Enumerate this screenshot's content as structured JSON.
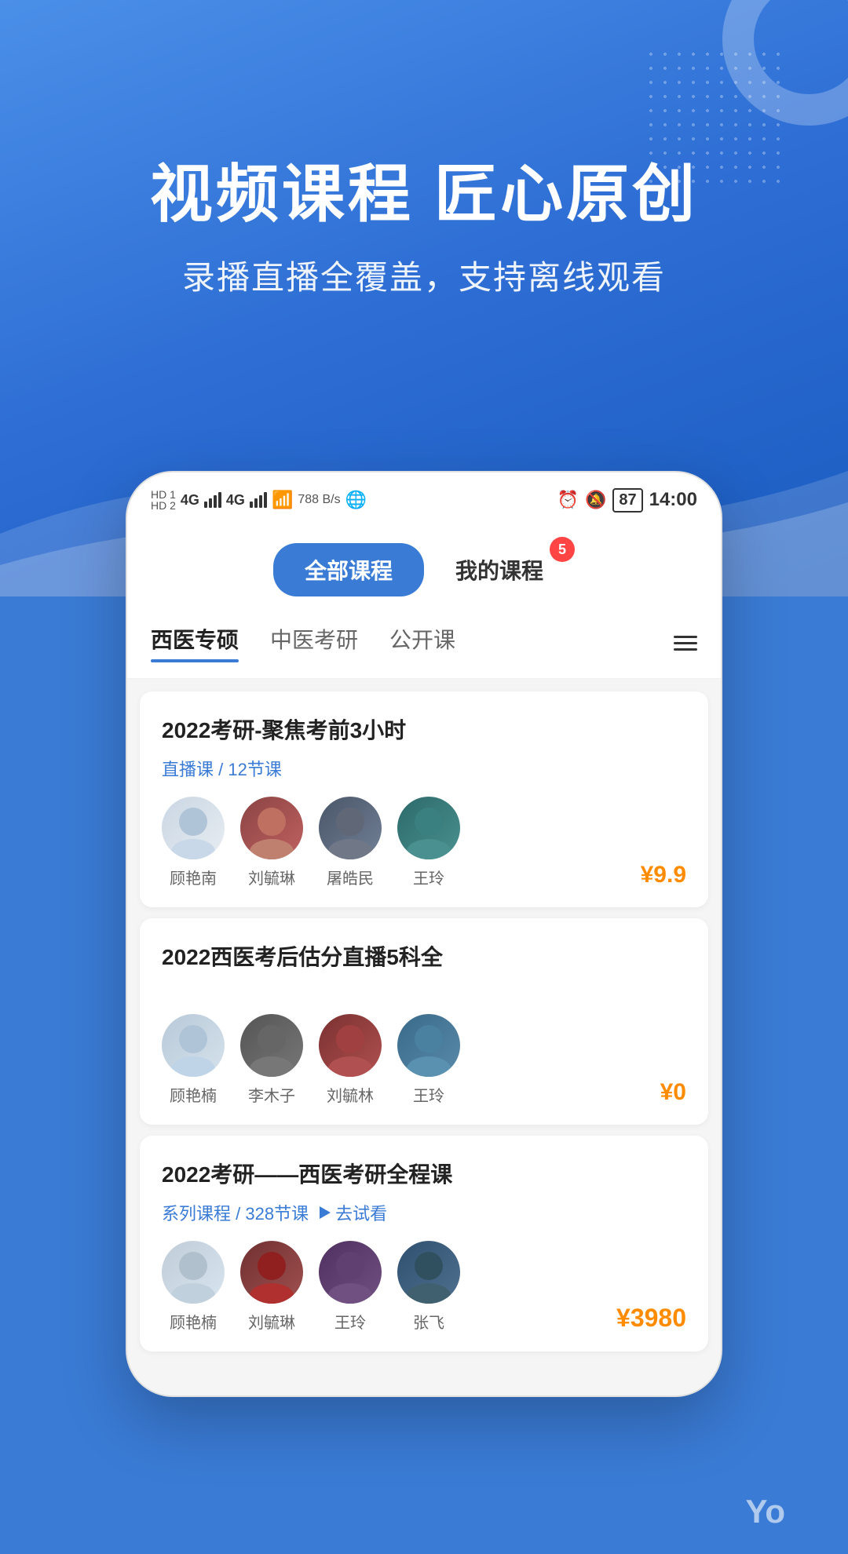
{
  "hero": {
    "title": "视频课程 匠心原创",
    "subtitle": "录播直播全覆盖，支持离线观看"
  },
  "statusBar": {
    "networks": "HD1 4G HD2 4G",
    "speed": "788 B/s",
    "time": "14:00",
    "battery": "87"
  },
  "tabs": {
    "all_label": "全部课程",
    "my_label": "我的课程",
    "badge": "5"
  },
  "categories": [
    {
      "label": "西医专硕",
      "active": true
    },
    {
      "label": "中医考研",
      "active": false
    },
    {
      "label": "公开课",
      "active": false
    }
  ],
  "courses": [
    {
      "title": "2022考研-聚焦考前3小时",
      "meta_type": "直播课",
      "meta_lessons": "12节课",
      "has_try": false,
      "teachers": [
        {
          "name": "顾艳南",
          "avatar_class": "avatar-1"
        },
        {
          "name": "刘毓琳",
          "avatar_class": "avatar-2"
        },
        {
          "name": "屠皓民",
          "avatar_class": "avatar-3"
        },
        {
          "name": "王玲",
          "avatar_class": "avatar-4"
        }
      ],
      "price": "¥9.9"
    },
    {
      "title": "2022西医考后估分直播5科全",
      "meta_type": "",
      "meta_lessons": "",
      "has_try": false,
      "teachers": [
        {
          "name": "顾艳楠",
          "avatar_class": "avatar-a1"
        },
        {
          "name": "李木子",
          "avatar_class": "avatar-a2"
        },
        {
          "name": "刘毓林",
          "avatar_class": "avatar-a3"
        },
        {
          "name": "王玲",
          "avatar_class": "avatar-a4"
        }
      ],
      "price": "¥0"
    },
    {
      "title": "2022考研——西医考研全程课",
      "meta_type": "系列课程",
      "meta_lessons": "328节课",
      "has_try": true,
      "try_label": "去试看",
      "teachers": [
        {
          "name": "顾艳楠",
          "avatar_class": "avatar-b1"
        },
        {
          "name": "刘毓琳",
          "avatar_class": "avatar-b2"
        },
        {
          "name": "王玲",
          "avatar_class": "avatar-b3"
        },
        {
          "name": "张飞",
          "avatar_class": "avatar-b4"
        }
      ],
      "price": "¥3980"
    }
  ],
  "bottom": {
    "yo": "Yo"
  }
}
